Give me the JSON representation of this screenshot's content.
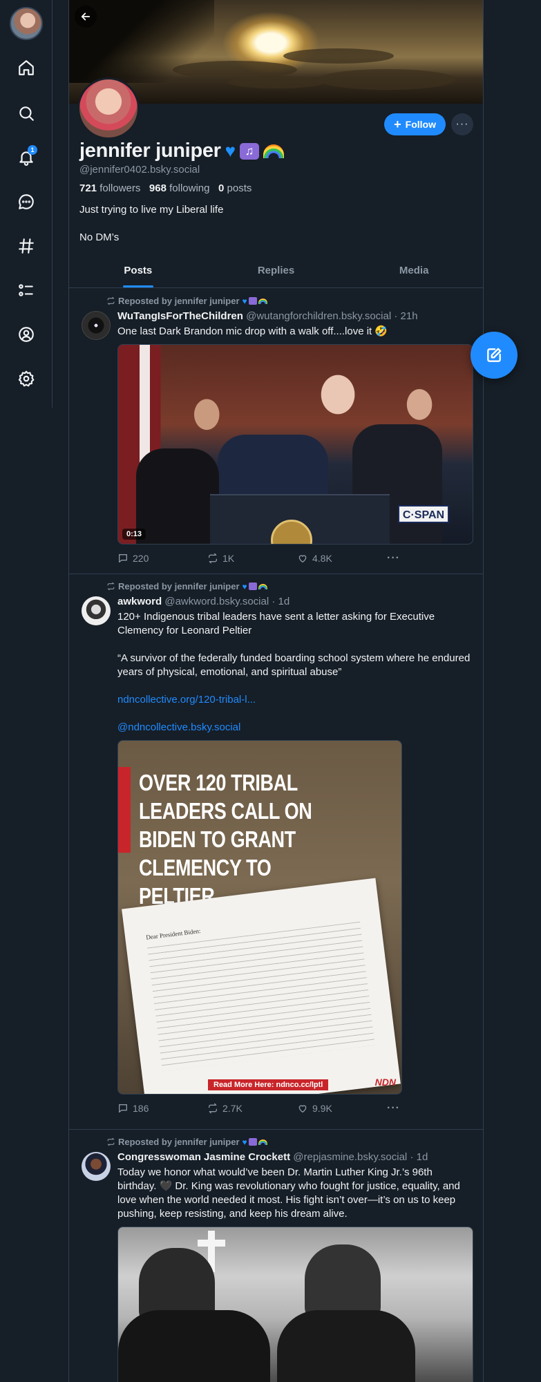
{
  "rail": {
    "items": [
      {
        "name": "home",
        "icon": "home-icon"
      },
      {
        "name": "search",
        "icon": "search-icon"
      },
      {
        "name": "notifications",
        "icon": "bell-icon",
        "badge": "1"
      },
      {
        "name": "chat",
        "icon": "chat-icon"
      },
      {
        "name": "feeds",
        "icon": "hashtag-icon"
      },
      {
        "name": "lists",
        "icon": "list-icon"
      },
      {
        "name": "profile",
        "icon": "user-circle-icon"
      },
      {
        "name": "settings",
        "icon": "gear-icon"
      }
    ]
  },
  "profile": {
    "display_name": "jennifer juniper",
    "name_emojis": [
      "blue-heart",
      "musical-notes",
      "rainbow"
    ],
    "handle": "@jennifer0402.bsky.social",
    "followers_count": "721",
    "followers_label": "followers",
    "following_count": "968",
    "following_label": "following",
    "posts_count": "0",
    "posts_label": "posts",
    "bio_line1": "Just trying to live my Liberal life",
    "bio_line2": "No DM’s",
    "follow_label": "Follow",
    "more_label": "···"
  },
  "tabs": [
    {
      "label": "Posts",
      "active": true
    },
    {
      "label": "Replies",
      "active": false
    },
    {
      "label": "Media",
      "active": false
    }
  ],
  "posts": [
    {
      "repost_label": "Reposted by jennifer juniper",
      "author": "WuTangIsForTheChildren",
      "handle": "@wutangforchildren.bsky.social",
      "time": "· 21h",
      "text": "One last Dark Brandon mic drop with a walk off....love it 🤣",
      "video_duration": "0:13",
      "video_watermark": "C·SPAN",
      "replies": "220",
      "reposts": "1K",
      "likes": "4.8K"
    },
    {
      "repost_label": "Reposted by jennifer juniper",
      "author": "awkword",
      "handle": "@awkword.bsky.social",
      "time": "· 1d",
      "text_p1": "120+ Indigenous tribal leaders have sent a letter asking for Executive Clemency for Leonard Peltier",
      "text_p2": "“A survivor of the federally funded boarding school system where he endured years of physical, emotional, and spiritual abuse”",
      "link1": "ndncollective.org/120-tribal-l...",
      "link2": "@ndncollective.bsky.social",
      "image_headline": "OVER 120 TRIBAL LEADERS CALL ON BIDEN TO GRANT CLEMENCY TO PELTIER",
      "image_letter_greeting": "Dear President Biden:",
      "image_cta": "Read More Here: ndnco.cc/lptl",
      "image_logo": "NDN",
      "replies": "186",
      "reposts": "2.7K",
      "likes": "9.9K"
    },
    {
      "repost_label": "Reposted by jennifer juniper",
      "author": "Congresswoman Jasmine Crockett",
      "handle": "@repjasmine.bsky.social",
      "time": "· 1d",
      "text": "Today we honor what would’ve been Dr. Martin Luther King Jr.’s 96th birthday. 🖤 Dr. King was revolutionary who fought for justice, equality, and love when the world needed it most. His fight isn’t over—it’s on us to keep pushing, keep resisting, and keep his dream alive."
    }
  ],
  "colors": {
    "background": "#161e27",
    "accent": "#208bfe",
    "muted": "#8b98a5",
    "border": "#2e4052"
  }
}
